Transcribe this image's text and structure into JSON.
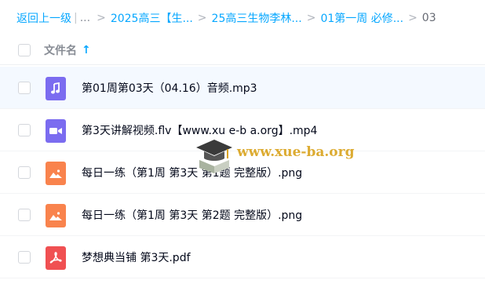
{
  "breadcrumb": {
    "back_label": "返回上一级",
    "ellipsis": "...",
    "items": [
      "2025高三【生...",
      "25高三生物李林...",
      "01第一周 必修..."
    ],
    "current": "03"
  },
  "header": {
    "name_column": "文件名",
    "sort_indicator": "↑"
  },
  "files": [
    {
      "name": "第01周第03天（04.16）音频.mp3",
      "type": "audio",
      "icon": "music-note-icon",
      "color": "#7b6cf0"
    },
    {
      "name": "第3天讲解视频.flv【www.xu e-b a.org】.mp4",
      "type": "video",
      "icon": "video-camera-icon",
      "color": "#7b6cf0"
    },
    {
      "name": "每日一练（第1周 第3天 第1题 完整版）.png",
      "type": "image",
      "icon": "image-icon",
      "color": "#f9834d"
    },
    {
      "name": "每日一练（第1周 第3天 第2题 完整版）.png",
      "type": "image",
      "icon": "image-icon",
      "color": "#f9834d"
    },
    {
      "name": "梦想典当铺 第3天.pdf",
      "type": "pdf",
      "icon": "pdf-icon",
      "color": "#f05052"
    }
  ],
  "watermark": {
    "text": "www.xue-ba.org",
    "icon": "graduation-cap-logo"
  },
  "colors": {
    "link": "#06a7ff",
    "row_hover": "#f4f9ff",
    "audio_video": "#7b6cf0",
    "image": "#f9834d",
    "pdf": "#f05052"
  }
}
